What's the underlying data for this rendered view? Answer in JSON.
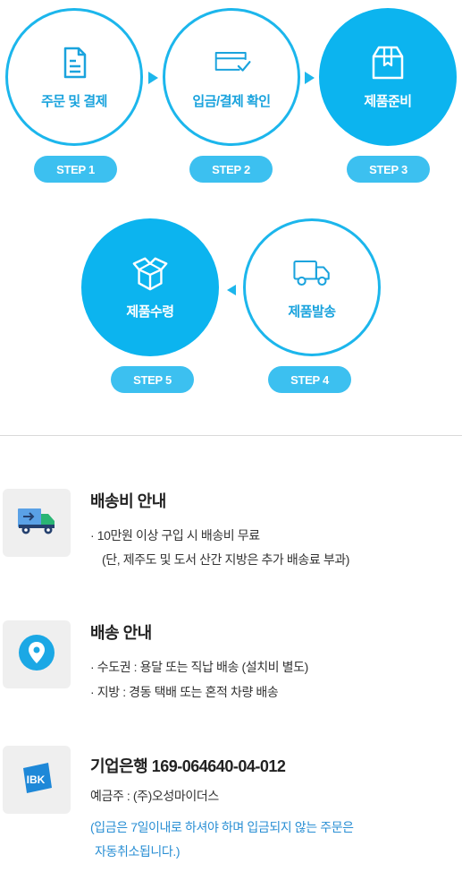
{
  "steps": [
    {
      "label": "주문 및 결제",
      "step": "STEP 1",
      "icon": "document-icon",
      "active": false
    },
    {
      "label": "입금/결제 확인",
      "step": "STEP 2",
      "icon": "card-check-icon",
      "active": false
    },
    {
      "label": "제품준비",
      "step": "STEP 3",
      "icon": "box-icon",
      "active": true
    },
    {
      "label": "제품발송",
      "step": "STEP 4",
      "icon": "truck-icon",
      "active": false
    },
    {
      "label": "제품수령",
      "step": "STEP 5",
      "icon": "open-box-icon",
      "active": true
    }
  ],
  "shipping_fee": {
    "title": "배송비 안내",
    "lines": [
      "· 10만원 이상 구입 시 배송비 무료",
      "(단, 제주도 및 도서 산간 지방은 추가 배송료 부과)"
    ]
  },
  "delivery": {
    "title": "배송 안내",
    "lines": [
      "· 수도권 : 용달 또는  직납 배송 (설치비 별도)",
      "· 지방 : 경동 택배 또는 혼적 차량 배송"
    ]
  },
  "bank": {
    "title": "기업은행  169-064640-04-012",
    "holder": "예금주 : (주)오성마이더스",
    "note_lines": [
      "(입금은 7일이내로 하셔야 하며 입금되지 않는 주문은",
      "자동취소됩니다.)"
    ],
    "logo_text": "IBK"
  },
  "colors": {
    "accent": "#0cb4ef",
    "pill": "#3cc0f0",
    "note": "#2a8fd4"
  }
}
